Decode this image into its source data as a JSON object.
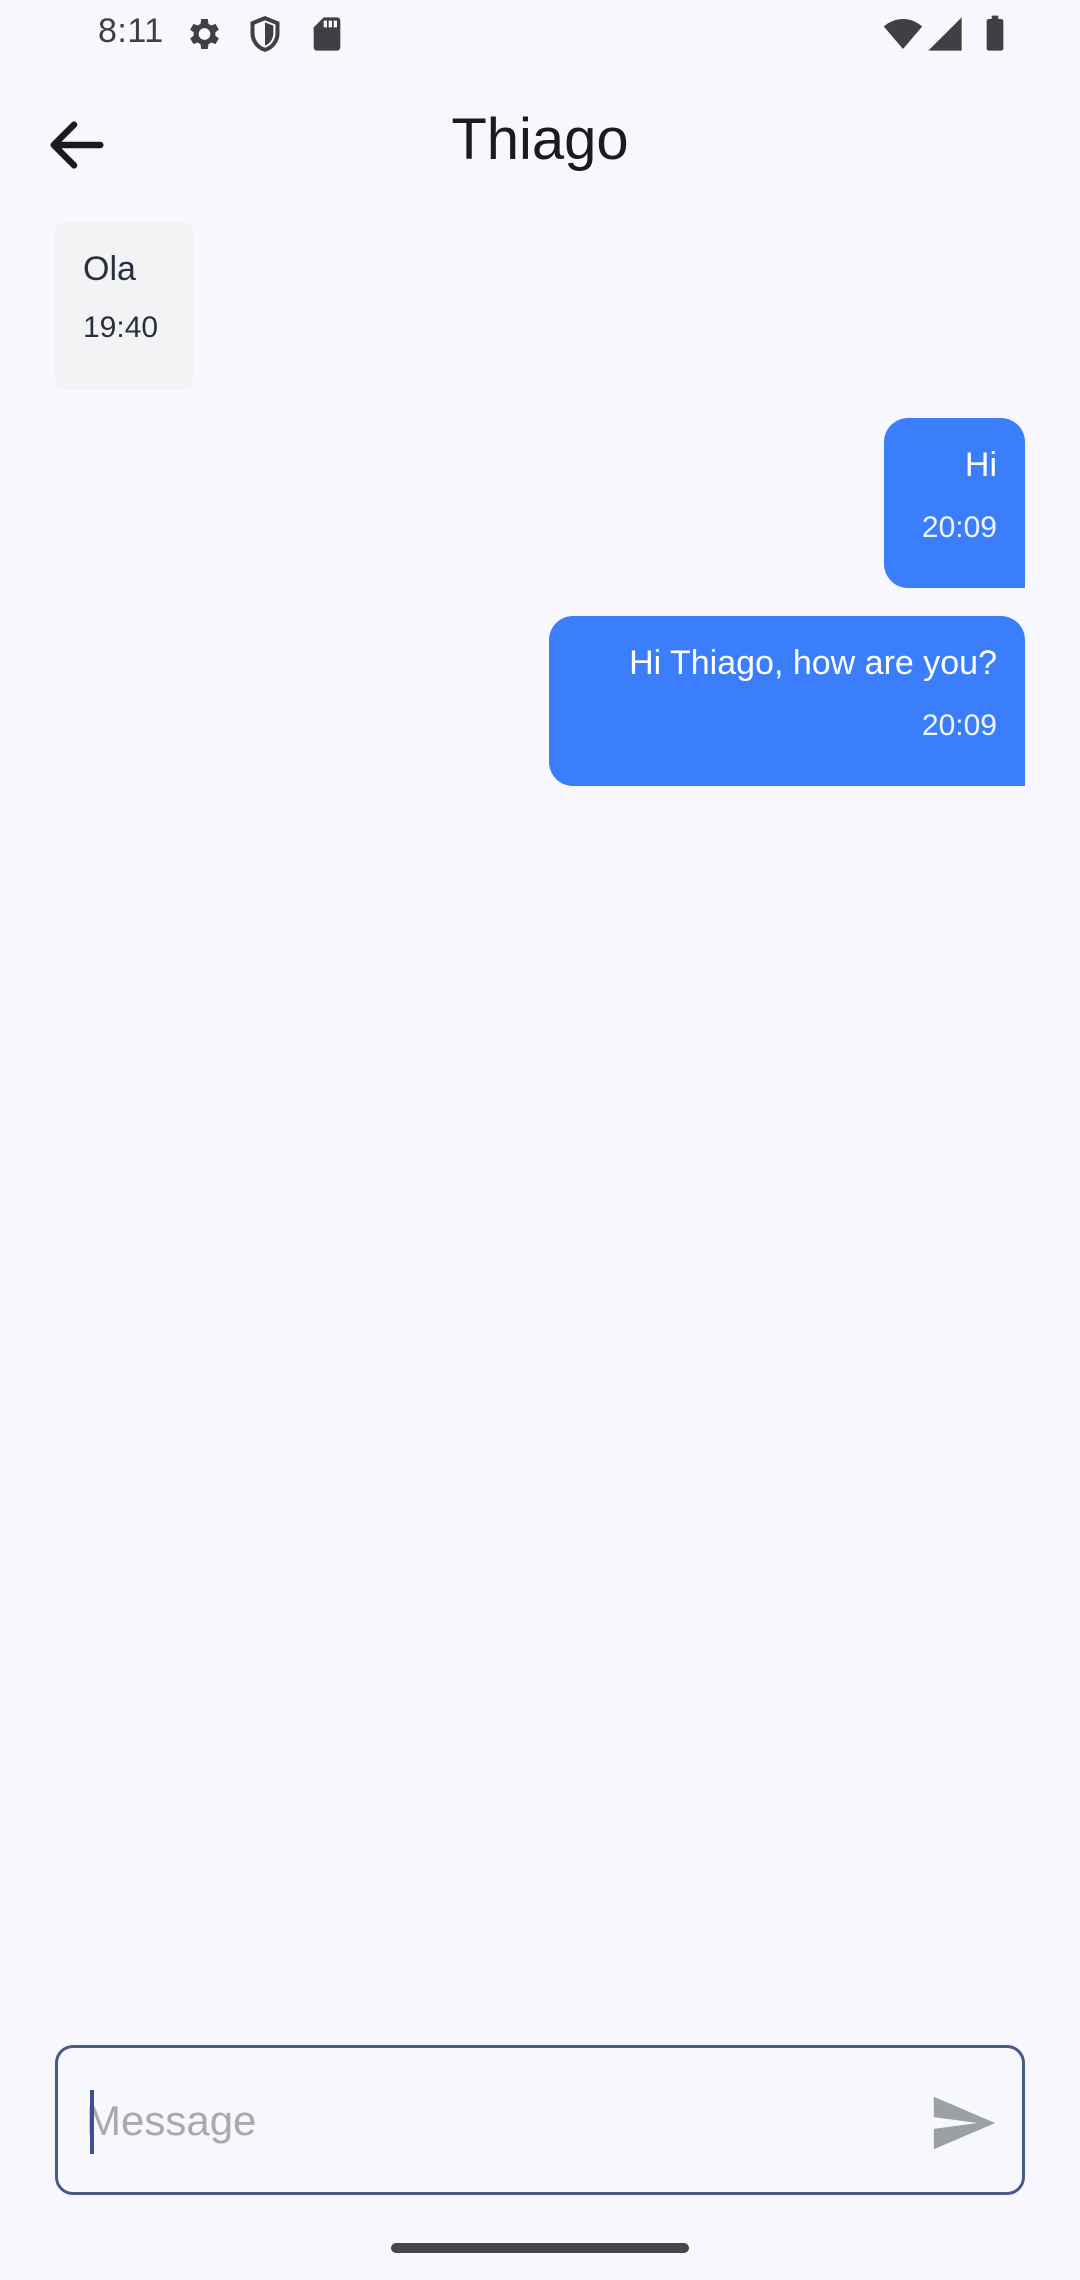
{
  "status_bar": {
    "time": "8:11",
    "icons": [
      "settings-icon",
      "shield-icon",
      "sd-card-icon",
      "wifi-icon",
      "signal-icon",
      "battery-icon"
    ]
  },
  "app_bar": {
    "title": "Thiago",
    "back_icon": "arrow-left-icon"
  },
  "messages": [
    {
      "direction": "incoming",
      "text": "Ola",
      "time": "19:40"
    },
    {
      "direction": "outgoing",
      "text": "Hi",
      "time": "20:09"
    },
    {
      "direction": "outgoing",
      "text": "Hi Thiago, how are you?",
      "time": "20:09"
    }
  ],
  "composer": {
    "placeholder": "Message",
    "value": "",
    "send_icon": "send-icon"
  },
  "colors": {
    "background": "#f8f7fe",
    "outgoing_bubble": "#3a7efc",
    "incoming_bubble": "#f3f3f6",
    "composer_border": "#4a5a8a"
  }
}
